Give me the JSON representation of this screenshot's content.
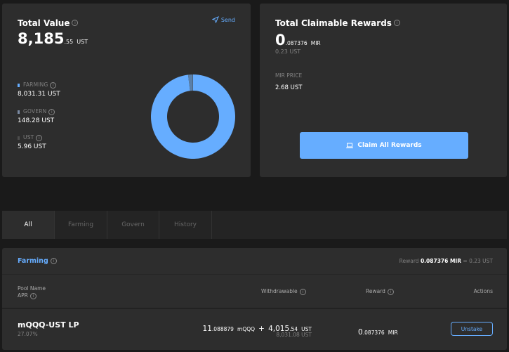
{
  "total_value": {
    "title": "Total Value",
    "send_label": "Send",
    "amount_int": "8,185",
    "amount_dec": ".55",
    "amount_unit": "UST",
    "legend": [
      {
        "label": "FARMING",
        "value": "8,031.31 UST",
        "color": "#66adff"
      },
      {
        "label": "GOVERN",
        "value": "148.28 UST",
        "color": "#7a8aa3"
      },
      {
        "label": "UST",
        "value": "5.96 UST",
        "color": "#4d4d4d"
      }
    ],
    "chart_data": {
      "type": "pie",
      "categories": [
        "FARMING",
        "GOVERN",
        "UST"
      ],
      "values": [
        8031.31,
        148.28,
        5.96
      ],
      "colors": [
        "#66adff",
        "#5a7fa8",
        "#3a3a3a"
      ],
      "title": ""
    }
  },
  "rewards": {
    "title": "Total Claimable Rewards",
    "amount_int": "0",
    "amount_dec": ".087376",
    "amount_unit": "MIR",
    "amount_ust": "0.23 UST",
    "price_label": "MIR PRICE",
    "price_value": "2.68 UST",
    "claim_label": "Claim All Rewards"
  },
  "tabs": [
    "All",
    "Farming",
    "Govern",
    "History"
  ],
  "farming": {
    "title": "Farming",
    "reward_label": "Reward",
    "reward_mir": "0.087376 MIR",
    "reward_sep": "=",
    "reward_ust": "0.23 UST",
    "columns": {
      "pool": "Pool Name",
      "apr": "APR",
      "withdrawable": "Withdrawable",
      "reward": "Reward",
      "actions": "Actions"
    },
    "row": {
      "pool_name": "mQQQ-UST LP",
      "apr": "27.07%",
      "w_mqqq_int": "11",
      "w_mqqq_dec": ".088879",
      "w_mqqq_unit": "mQQQ",
      "w_plus": "+",
      "w_ust_int": "4,015",
      "w_ust_dec": ".54",
      "w_ust_unit": "UST",
      "w_total": "8,031.08 UST",
      "reward_int": "0",
      "reward_dec": ".087376",
      "reward_unit": "MIR",
      "action_label": "Unstake"
    }
  }
}
